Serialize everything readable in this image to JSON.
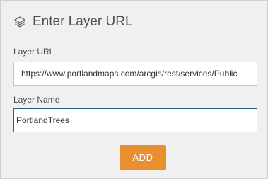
{
  "header": {
    "icon": "layers-icon",
    "title": "Enter Layer URL"
  },
  "layer_url": {
    "label": "Layer URL",
    "value": "https://www.portlandmaps.com/arcgis/rest/services/Public"
  },
  "layer_name": {
    "label": "Layer Name",
    "value": "PortlandTrees"
  },
  "actions": {
    "add_label": "ADD"
  },
  "colors": {
    "panel_background": "#f0f0f0",
    "accent_button": "#e88f2f",
    "focused_input_border": "#2b5d9a"
  }
}
